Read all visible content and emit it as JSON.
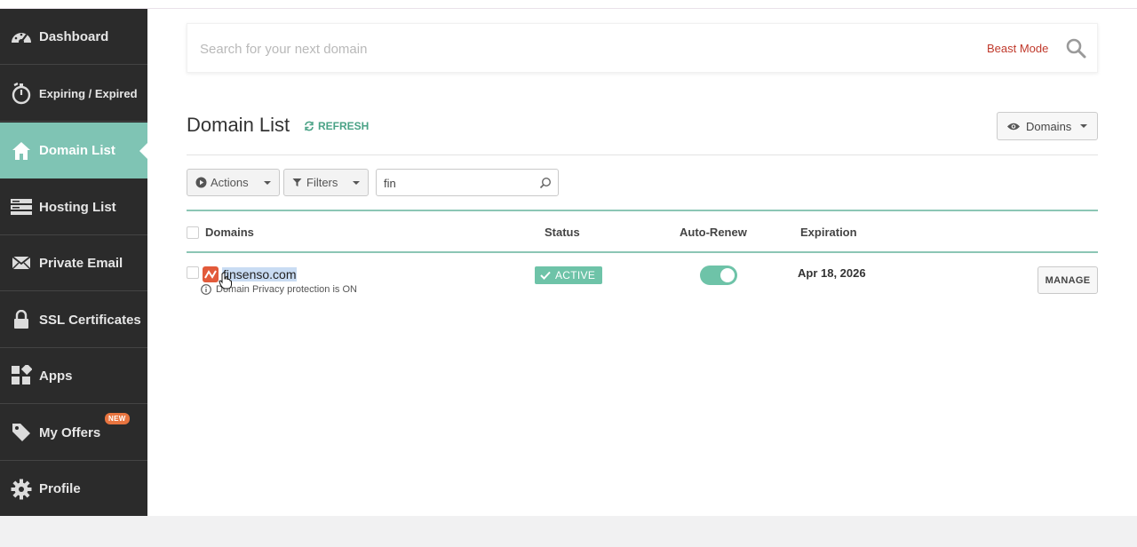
{
  "sidebar": {
    "items": [
      {
        "label": "Dashboard",
        "icon": "gauge-icon"
      },
      {
        "label": "Expiring / Expired",
        "icon": "stopwatch-icon"
      },
      {
        "label": "Domain List",
        "icon": "home-icon",
        "active": true
      },
      {
        "label": "Hosting List",
        "icon": "server-icon"
      },
      {
        "label": "Private Email",
        "icon": "envelope-icon"
      },
      {
        "label": "SSL Certificates",
        "icon": "lock-icon"
      },
      {
        "label": "Apps",
        "icon": "apps-grid-icon"
      },
      {
        "label": "My Offers",
        "icon": "tag-icon",
        "badge": "NEW"
      },
      {
        "label": "Profile",
        "icon": "gear-icon"
      }
    ]
  },
  "search": {
    "placeholder": "Search for your next domain",
    "beast_mode": "Beast Mode"
  },
  "page": {
    "title": "Domain List",
    "refresh": "REFRESH",
    "view_button": "Domains"
  },
  "toolbar": {
    "actions": "Actions",
    "filters": "Filters",
    "filter_value": "fin"
  },
  "table": {
    "columns": {
      "domains": "Domains",
      "status": "Status",
      "auto_renew": "Auto-Renew",
      "expiration": "Expiration"
    },
    "rows": [
      {
        "domain": "finsenso.com",
        "note": "Domain Privacy protection is ON",
        "status": "ACTIVE",
        "auto_renew": true,
        "expiration": "Apr 18, 2026",
        "manage": "MANAGE"
      }
    ]
  },
  "colors": {
    "sidebar_bg": "#2b2b2b",
    "active_item": "#7fc4b4",
    "accent_green": "#6ec3a8",
    "beast_mode": "#c0392b",
    "badge_orange": "#e8743f"
  }
}
